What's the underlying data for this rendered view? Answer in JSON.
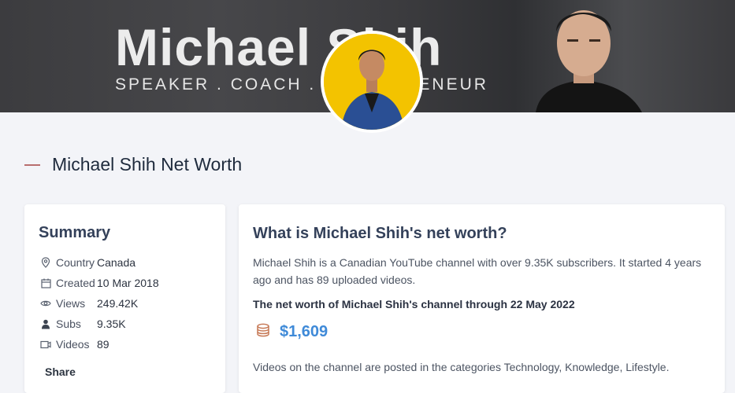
{
  "banner": {
    "name": "Michael Shih",
    "tagline": "SPEAKER . COACH . ENTREPRENEUR"
  },
  "section": {
    "title": "Michael Shih Net Worth"
  },
  "summary": {
    "title": "Summary",
    "rows": [
      {
        "icon": "location-pin-icon",
        "label": "Country",
        "value": "Canada"
      },
      {
        "icon": "calendar-icon",
        "label": "Created",
        "value": "10 Mar 2018"
      },
      {
        "icon": "eye-icon",
        "label": "Views",
        "value": "249.42K"
      },
      {
        "icon": "user-icon",
        "label": "Subs",
        "value": "9.35K"
      },
      {
        "icon": "video-icon",
        "label": "Videos",
        "value": "89"
      }
    ],
    "share_label": "Share"
  },
  "main": {
    "title": "What is Michael Shih's net worth?",
    "description": "Michael Shih is a Canadian YouTube channel with over 9.35K subscribers. It started 4 years ago and has 89 uploaded videos.",
    "networth_label": "The net worth of Michael Shih's channel through 22 May 2022",
    "networth_value": "$1,609",
    "categories_text": "Videos on the channel are posted in the categories Technology, Knowledge, Lifestyle."
  },
  "colors": {
    "accent_dash": "#b86e6e",
    "networth_blue": "#3f8ad8",
    "coin_icon": "#c77a57"
  }
}
